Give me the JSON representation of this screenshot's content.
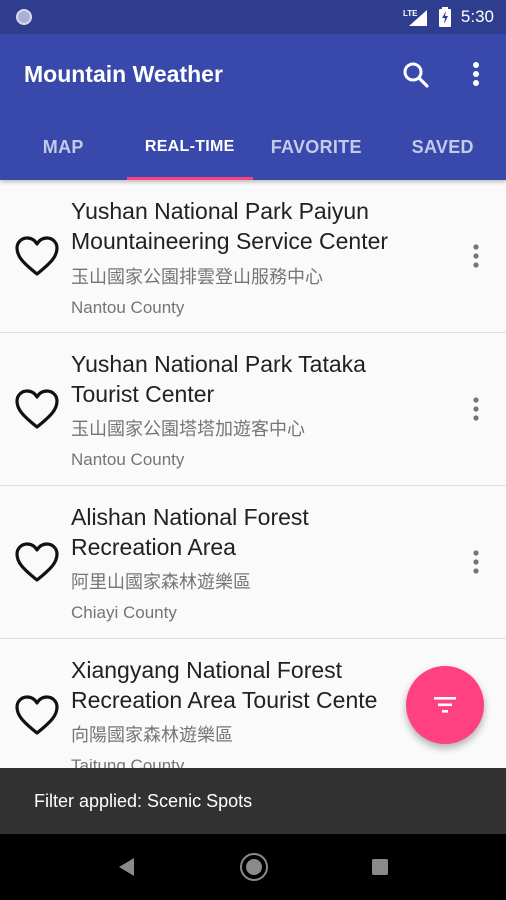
{
  "status_bar": {
    "time": "5:30",
    "network_label": "LTE"
  },
  "app_bar": {
    "title": "Mountain Weather",
    "search_icon": "search-icon",
    "more_icon": "more-vert-icon"
  },
  "tabs": [
    {
      "label": "MAP",
      "active": false
    },
    {
      "label": "REAL-TIME",
      "active": true
    },
    {
      "label": "FAVORITE",
      "active": false
    },
    {
      "label": "SAVED",
      "active": false
    }
  ],
  "items": [
    {
      "title_line1": "Yushan National Park Paiyun",
      "title_line2": "Mountaineering Service Center",
      "subtitle": "玉山國家公園排雲登山服務中心",
      "county": "Nantou County",
      "favorite": false
    },
    {
      "title_line1": "Yushan National Park Tataka",
      "title_line2": "Tourist Center",
      "subtitle": "玉山國家公園塔塔加遊客中心",
      "county": "Nantou County",
      "favorite": false
    },
    {
      "title_line1": "Alishan National Forest",
      "title_line2": "Recreation Area",
      "subtitle": "阿里山國家森林遊樂區",
      "county": "Chiayi County",
      "favorite": false
    },
    {
      "title_line1": "Xiangyang National Forest",
      "title_line2": "Recreation Area Tourist Cente",
      "subtitle": "向陽國家森林遊樂區",
      "county": "Taitung County",
      "favorite": false
    }
  ],
  "fab": {
    "icon": "filter-icon"
  },
  "snackbar": {
    "text": "Filter applied: Scenic Spots"
  },
  "colors": {
    "primary": "#3949ab",
    "primary_dark": "#2f3d8f",
    "accent": "#ff4081"
  }
}
